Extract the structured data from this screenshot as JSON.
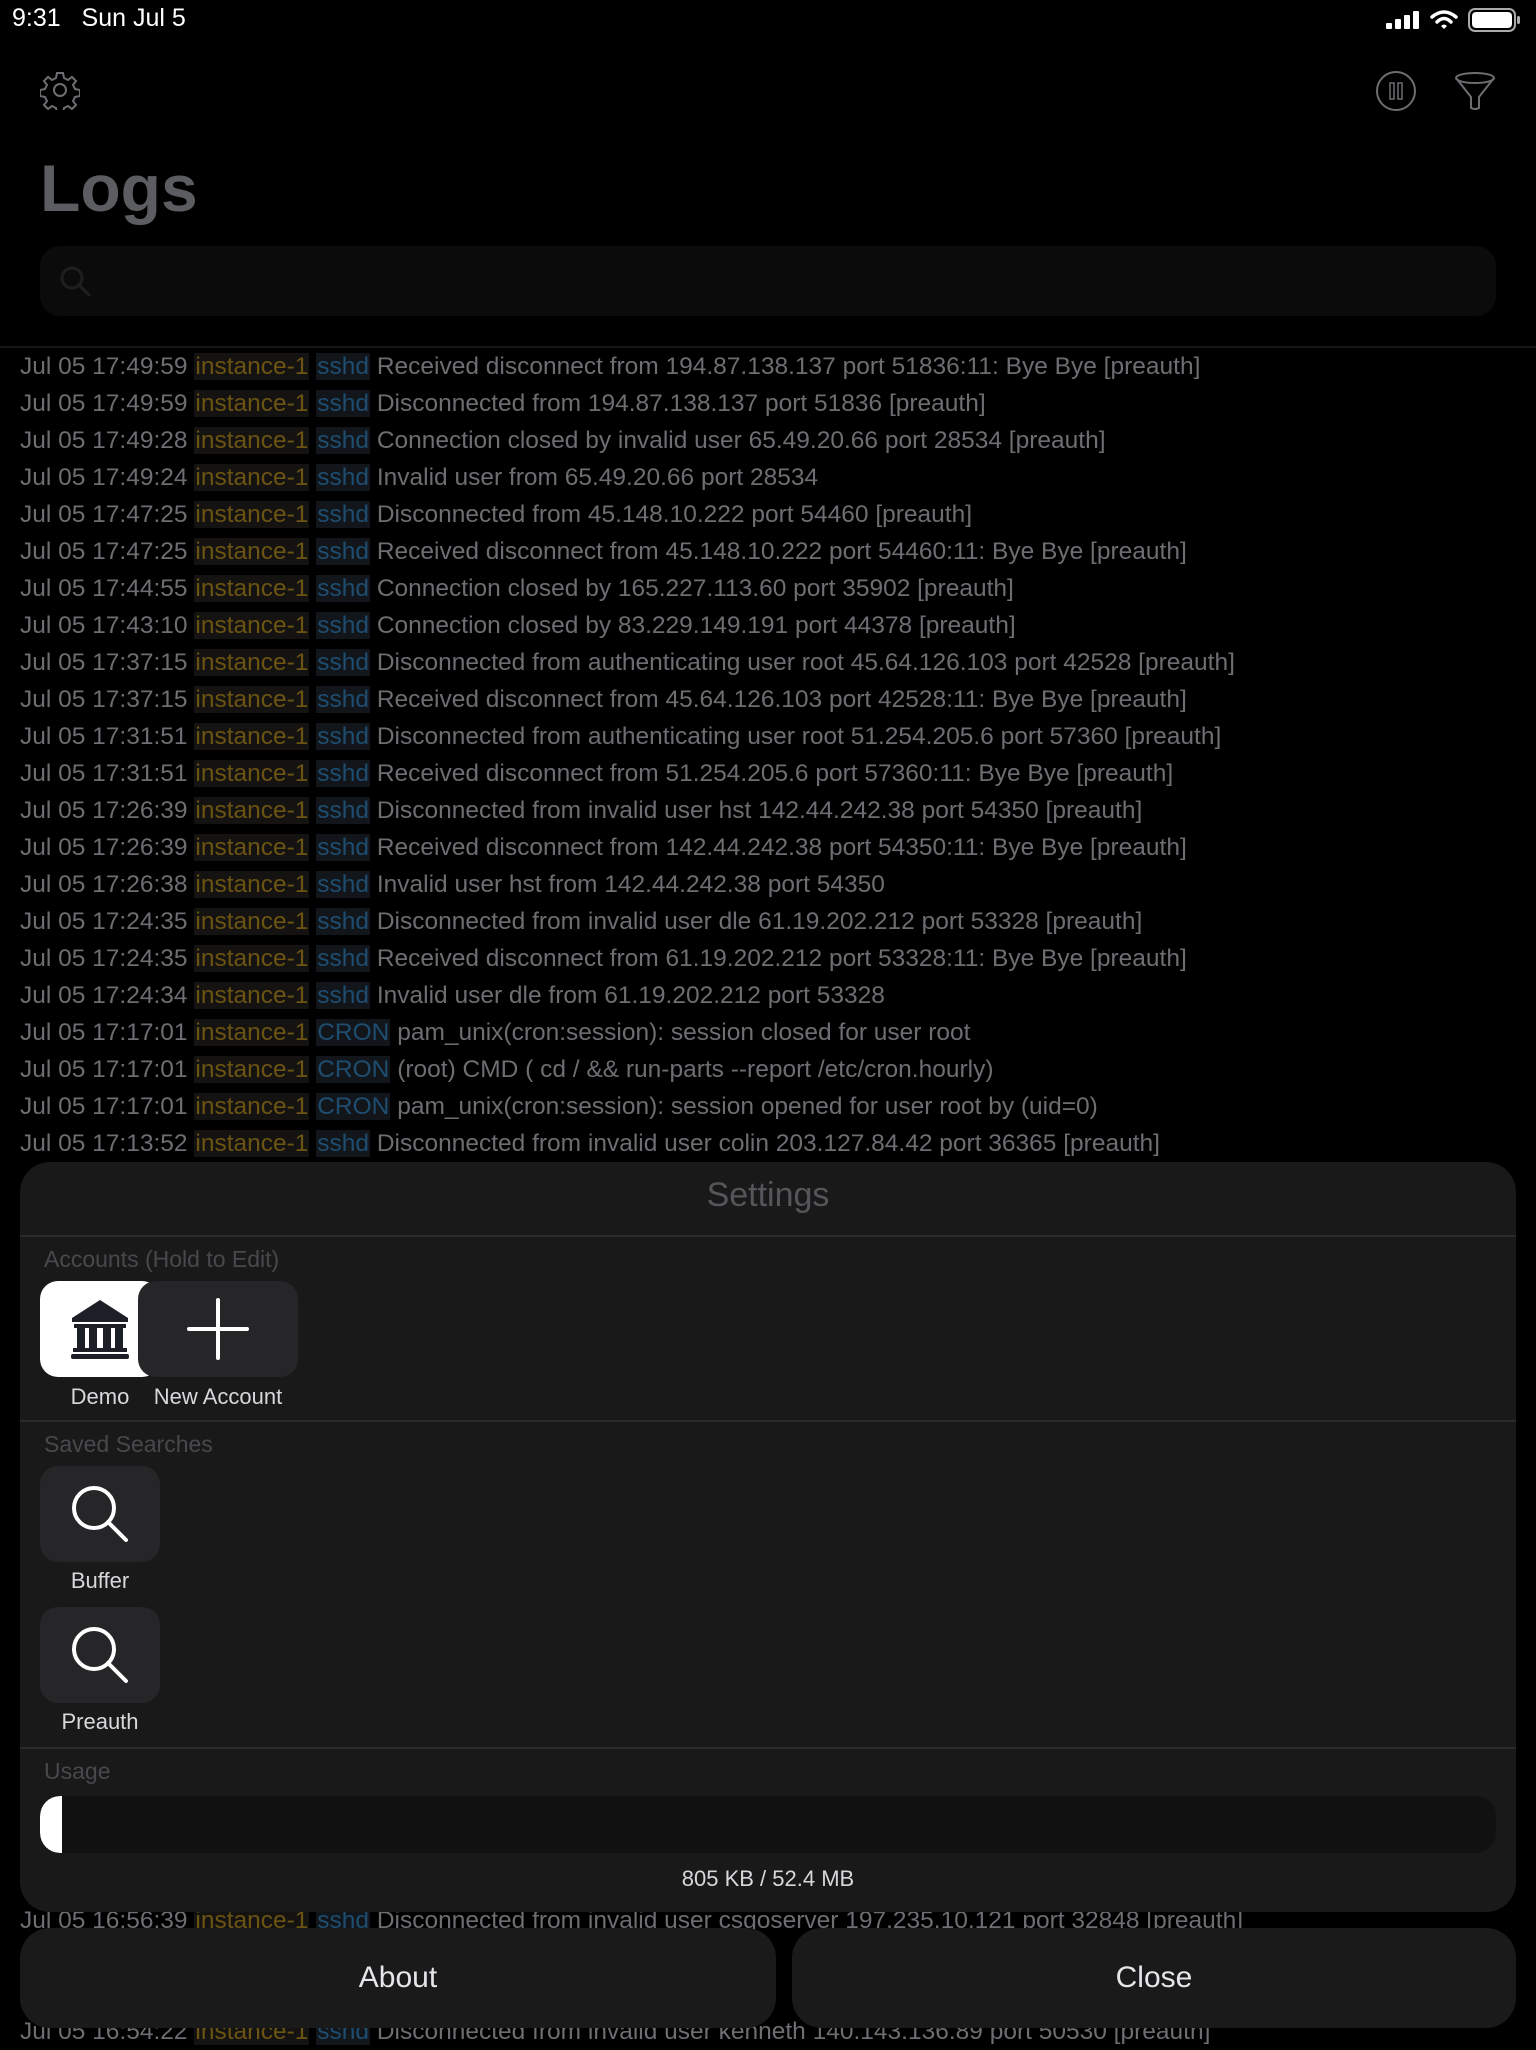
{
  "status_bar": {
    "time": "9:31",
    "date": "Sun Jul 5"
  },
  "nav": {
    "left_icon": "gear-icon",
    "right_icons": [
      "pause-icon",
      "filter-icon"
    ]
  },
  "header": {
    "title": "Logs",
    "search_placeholder": ""
  },
  "logs": [
    {
      "ts": "Jul 05 17:49:59",
      "host": "instance-1",
      "proc": "sshd",
      "msg": "Received disconnect from 194.87.138.137 port 51836:11: Bye Bye [preauth]"
    },
    {
      "ts": "Jul 05 17:49:59",
      "host": "instance-1",
      "proc": "sshd",
      "msg": "Disconnected from 194.87.138.137 port 51836 [preauth]"
    },
    {
      "ts": "Jul 05 17:49:28",
      "host": "instance-1",
      "proc": "sshd",
      "msg": "Connection closed by invalid user  65.49.20.66 port 28534 [preauth]"
    },
    {
      "ts": "Jul 05 17:49:24",
      "host": "instance-1",
      "proc": "sshd",
      "msg": "Invalid user  from 65.49.20.66 port 28534"
    },
    {
      "ts": "Jul 05 17:47:25",
      "host": "instance-1",
      "proc": "sshd",
      "msg": "Disconnected from 45.148.10.222 port 54460 [preauth]"
    },
    {
      "ts": "Jul 05 17:47:25",
      "host": "instance-1",
      "proc": "sshd",
      "msg": "Received disconnect from 45.148.10.222 port 54460:11: Bye Bye [preauth]"
    },
    {
      "ts": "Jul 05 17:44:55",
      "host": "instance-1",
      "proc": "sshd",
      "msg": "Connection closed by 165.227.113.60 port 35902 [preauth]"
    },
    {
      "ts": "Jul 05 17:43:10",
      "host": "instance-1",
      "proc": "sshd",
      "msg": "Connection closed by 83.229.149.191 port 44378 [preauth]"
    },
    {
      "ts": "Jul 05 17:37:15",
      "host": "instance-1",
      "proc": "sshd",
      "msg": "Disconnected from authenticating user root 45.64.126.103 port 42528 [preauth]"
    },
    {
      "ts": "Jul 05 17:37:15",
      "host": "instance-1",
      "proc": "sshd",
      "msg": "Received disconnect from 45.64.126.103 port 42528:11: Bye Bye [preauth]"
    },
    {
      "ts": "Jul 05 17:31:51",
      "host": "instance-1",
      "proc": "sshd",
      "msg": "Disconnected from authenticating user root 51.254.205.6 port 57360 [preauth]"
    },
    {
      "ts": "Jul 05 17:31:51",
      "host": "instance-1",
      "proc": "sshd",
      "msg": "Received disconnect from 51.254.205.6 port 57360:11: Bye Bye [preauth]"
    },
    {
      "ts": "Jul 05 17:26:39",
      "host": "instance-1",
      "proc": "sshd",
      "msg": "Disconnected from invalid user hst 142.44.242.38 port 54350 [preauth]"
    },
    {
      "ts": "Jul 05 17:26:39",
      "host": "instance-1",
      "proc": "sshd",
      "msg": "Received disconnect from 142.44.242.38 port 54350:11: Bye Bye [preauth]"
    },
    {
      "ts": "Jul 05 17:26:38",
      "host": "instance-1",
      "proc": "sshd",
      "msg": "Invalid user hst from 142.44.242.38 port 54350"
    },
    {
      "ts": "Jul 05 17:24:35",
      "host": "instance-1",
      "proc": "sshd",
      "msg": "Disconnected from invalid user dle 61.19.202.212 port 53328 [preauth]"
    },
    {
      "ts": "Jul 05 17:24:35",
      "host": "instance-1",
      "proc": "sshd",
      "msg": "Received disconnect from 61.19.202.212 port 53328:11: Bye Bye [preauth]"
    },
    {
      "ts": "Jul 05 17:24:34",
      "host": "instance-1",
      "proc": "sshd",
      "msg": "Invalid user dle from 61.19.202.212 port 53328"
    },
    {
      "ts": "Jul 05 17:17:01",
      "host": "instance-1",
      "proc": "CRON",
      "msg": "pam_unix(cron:session): session closed for user root"
    },
    {
      "ts": "Jul 05 17:17:01",
      "host": "instance-1",
      "proc": "CRON",
      "msg": "(root) CMD (   cd / && run-parts --report /etc/cron.hourly)"
    },
    {
      "ts": "Jul 05 17:17:01",
      "host": "instance-1",
      "proc": "CRON",
      "msg": "pam_unix(cron:session): session opened for user root by (uid=0)"
    },
    {
      "ts": "Jul 05 17:13:52",
      "host": "instance-1",
      "proc": "sshd",
      "msg": "Disconnected from invalid user colin 203.127.84.42 port 36365 [preauth]"
    }
  ],
  "logs_behind_panel": [
    {
      "ts": "Jul 05 16:56:39",
      "host": "instance-1",
      "proc": "sshd",
      "msg": "Disconnected from invalid user csgoserver 197.235.10.121 port 32848 [preauth]"
    },
    {
      "ts": "Jul 05 16:54:22",
      "host": "instance-1",
      "proc": "sshd",
      "msg": "Disconnected from invalid user kenneth 140.143.136.89 port 50530 [preauth]"
    }
  ],
  "settings": {
    "title": "Settings",
    "accounts_label": "Accounts (Hold to Edit)",
    "accounts": [
      {
        "label": "Demo",
        "icon": "bank-icon",
        "selected": true
      },
      {
        "label": "New Account",
        "icon": "plus-icon",
        "selected": false
      }
    ],
    "saved_searches_label": "Saved Searches",
    "saved_searches": [
      {
        "label": "Buffer",
        "icon": "search-icon"
      },
      {
        "label": "Preauth",
        "icon": "search-icon"
      }
    ],
    "usage_label": "Usage",
    "usage_fraction": 0.015,
    "usage_text": "805 KB / 52.4 MB"
  },
  "buttons": {
    "about": "About",
    "close": "Close"
  }
}
